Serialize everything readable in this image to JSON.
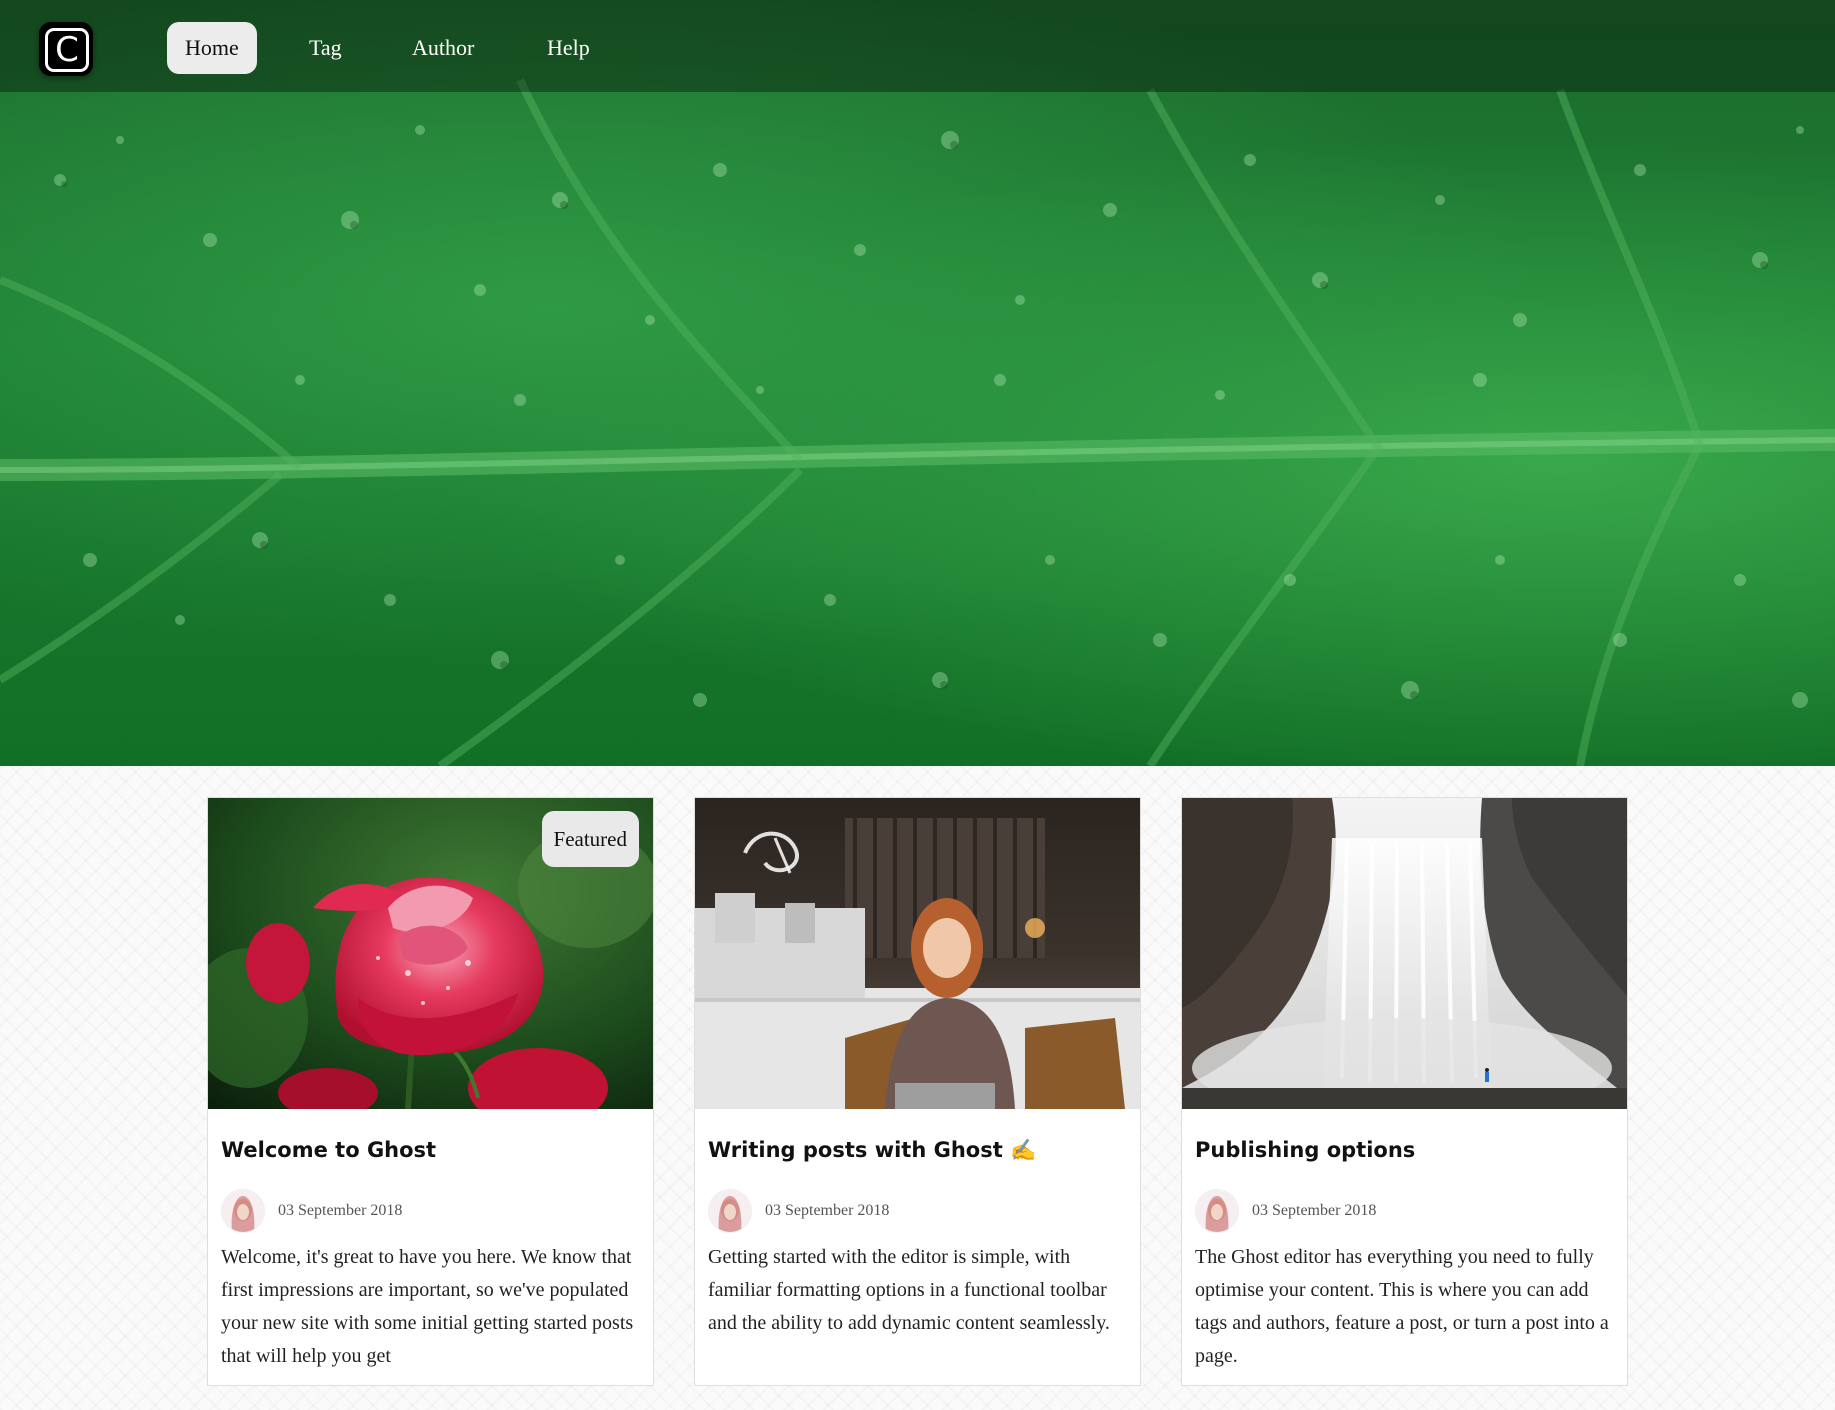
{
  "nav": {
    "logo_letter": "C",
    "items": [
      {
        "label": "Home",
        "active": true
      },
      {
        "label": "Tag",
        "active": false
      },
      {
        "label": "Author",
        "active": false
      },
      {
        "label": "Help",
        "active": false
      }
    ]
  },
  "hero": {
    "image": "green-leaf-with-water-droplets",
    "colors": {
      "base": "#1a7a31",
      "vein": "#4fb45c"
    }
  },
  "posts": [
    {
      "image": "red-rose",
      "badge": "Featured",
      "title": "Welcome to Ghost",
      "date": "03 September 2018",
      "excerpt": "Welcome, it's great to have you here. We know that first impressions are important, so we've populated your new site with some initial getting started posts that will help you get"
    },
    {
      "image": "woman-with-laptop-in-cafe",
      "title": "Writing posts with Ghost ✍️",
      "date": "03 September 2018",
      "excerpt": "Getting started with the editor is simple, with familiar formatting options in a functional toolbar and the ability to add dynamic content seamlessly."
    },
    {
      "image": "waterfall",
      "title": "Publishing options",
      "date": "03 September 2018",
      "excerpt": "The Ghost editor has everything you need to fully optimise your content. This is where you can add tags and authors, feature a post, or turn a post into a page."
    }
  ]
}
